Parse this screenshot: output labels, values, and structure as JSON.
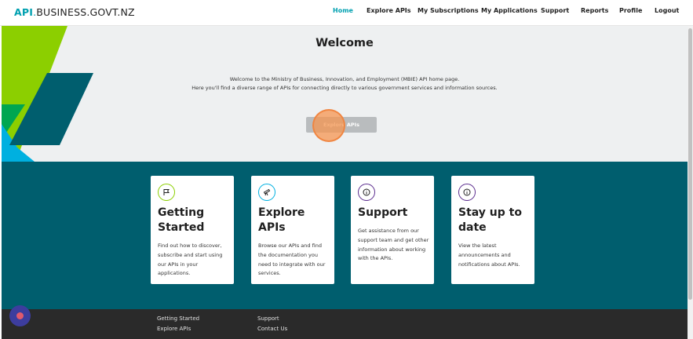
{
  "header": {
    "logo": {
      "part1": "API",
      "dot": ".",
      "part2": "BUSINESS.GOVT.NZ"
    },
    "nav": [
      {
        "label": "Home",
        "active": true
      },
      {
        "label": "Explore APIs",
        "active": false
      },
      {
        "label": "My Subscriptions",
        "active": false
      },
      {
        "label": "My Applications",
        "active": false
      },
      {
        "label": "Support",
        "active": false
      },
      {
        "label": "Reports",
        "active": false
      },
      {
        "label": "Profile",
        "active": false
      },
      {
        "label": "Logout",
        "active": false
      }
    ]
  },
  "hero": {
    "title": "Welcome",
    "line1": "Welcome to the Ministry of Business, Innovation, and Employment (MBIE) API home page.",
    "line2": "Here you'll find a diverse range of APIs for connecting directly to various government services and information sources.",
    "button_label": "Explore APIs"
  },
  "cards": [
    {
      "icon": "flag-icon",
      "title": "Getting Started",
      "text": "Find out how to discover, subscribe and start using our APIs in your applications."
    },
    {
      "icon": "telescope-icon",
      "title": "Explore APIs",
      "text": "Browse our APIs and find the documentation you need to integrate with our services."
    },
    {
      "icon": "info-icon",
      "title": "Support",
      "text": "Get assistance from our support team and get other information about working with the APIs."
    },
    {
      "icon": "info-icon",
      "title": "Stay up to date",
      "text": "View the latest announcements and notifications about APIs."
    }
  ],
  "footer": {
    "col1": [
      "Getting Started",
      "Explore APIs"
    ],
    "col2": [
      "Support",
      "Contact Us"
    ]
  },
  "colors": {
    "accent": "#00a0b0",
    "band": "#005e6e",
    "lime": "#8ccf00",
    "green": "#00a651",
    "cyan": "#00b0e0",
    "purple": "#5b2d8e",
    "footer": "#2a2a2a"
  }
}
